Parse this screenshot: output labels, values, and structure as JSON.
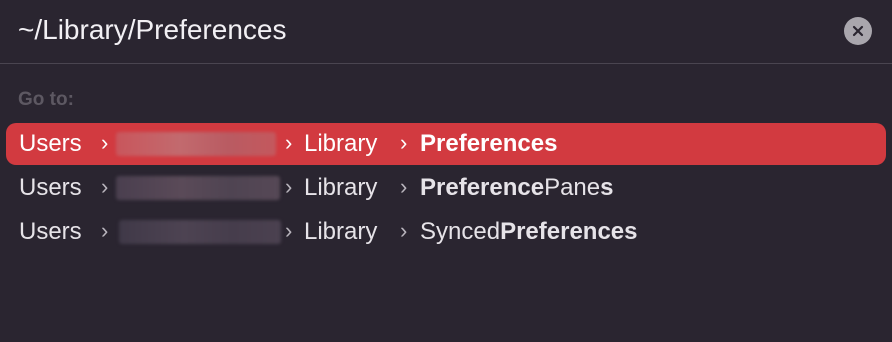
{
  "path_bar": {
    "value": "~/Library/Preferences",
    "clear_icon": "close-icon"
  },
  "goto_label": "Go to:",
  "results": [
    {
      "users": "Users",
      "library": "Library",
      "leaf_parts": [
        {
          "text": "Preferences",
          "bold": true
        }
      ],
      "selected": true
    },
    {
      "users": "Users",
      "library": "Library",
      "leaf_parts": [
        {
          "text": "Preference",
          "bold": true
        },
        {
          "text": "Pane",
          "bold": false
        },
        {
          "text": "s",
          "bold": true
        }
      ],
      "selected": false
    },
    {
      "users": "Users",
      "library": "Library",
      "leaf_parts": [
        {
          "text": "Synced",
          "bold": false
        },
        {
          "text": "Preferences",
          "bold": true
        }
      ],
      "selected": false
    }
  ],
  "separator_glyph": "›",
  "colors": {
    "background": "#2a2530",
    "selection": "#d23a40",
    "text": "#e6e3e8",
    "muted_label": "#5d5862"
  }
}
